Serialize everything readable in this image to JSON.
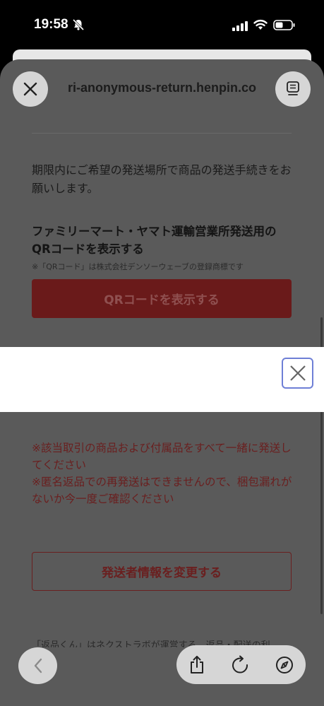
{
  "status_bar": {
    "time": "19:58"
  },
  "browser": {
    "url": "ri-anonymous-return.henpin.co"
  },
  "content": {
    "intro_text": "期限内にご希望の発送場所で商品の発送手続きをお願いします。",
    "qr_heading": "ファミリーマート・ヤマト運輸営業所発送用のQRコードを表示する",
    "qr_note": "※「QRコード」は株式会社デンソーウェーブの登録商標です",
    "qr_button_label": "QRコードを表示する",
    "warning_1": "※該当取引の商品および付属品をすべて一緒に発送してください",
    "warning_2": "※匿名返品での再発送はできませんので、梱包漏れがないか今一度ご確認ください",
    "change_button_label": "発送者情報を変更する",
    "footer_text": "「返品くん」はネクストラボが運営する、返品・配送の利"
  },
  "icons": {
    "status": [
      "bell-slash-icon",
      "signal-icon",
      "wifi-icon",
      "battery-icon"
    ],
    "toolbar": [
      "back-icon",
      "share-icon",
      "reload-icon",
      "compass-icon"
    ]
  },
  "colors": {
    "accent_red": "#6a1f1f",
    "banner_close_border": "#6e7fd6"
  }
}
